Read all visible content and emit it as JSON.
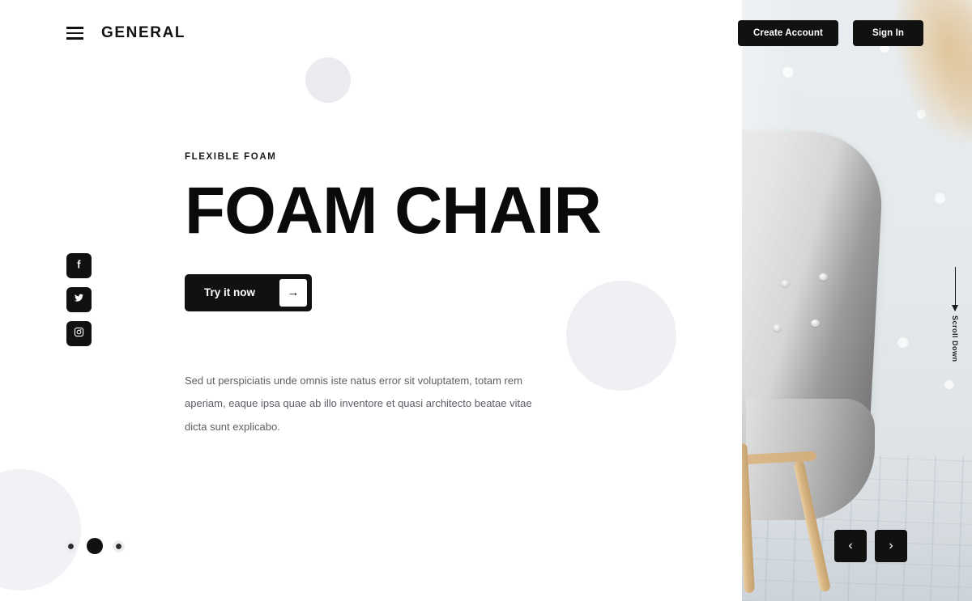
{
  "header": {
    "menu_icon": "hamburger-icon",
    "brand": "GENERAL",
    "create_account_label": "Create Account",
    "sign_in_label": "Sign In"
  },
  "social": {
    "items": [
      {
        "name": "facebook",
        "label": "Facebook"
      },
      {
        "name": "twitter",
        "label": "Twitter"
      },
      {
        "name": "instagram",
        "label": "Instagram"
      }
    ]
  },
  "hero": {
    "eyebrow": "FLEXIBLE FOAM",
    "title": "FOAM CHAIR",
    "cta_label": "Try it now",
    "cta_arrow": "→",
    "paragraph": "Sed ut perspiciatis unde omnis iste natus error sit voluptatem, totam rem aperiam, eaque ipsa quae ab illo inventore et quasi architecto beatae vitae dicta sunt explicabo."
  },
  "carousel": {
    "slides": [
      "1",
      "2",
      "3"
    ],
    "active_index": 1,
    "prev_label": "‹",
    "next_label": "›"
  },
  "scroll": {
    "label": "Scroll Down",
    "arrow": "↓"
  },
  "media": {
    "alt": "Light gray tufted foam armchair with wooden legs against a textured white wall"
  },
  "colors": {
    "accent": "#111111",
    "text": "#0a0a0a",
    "muted": "#5e5e66",
    "circle": "#ebebf0",
    "background": "#ffffff"
  }
}
